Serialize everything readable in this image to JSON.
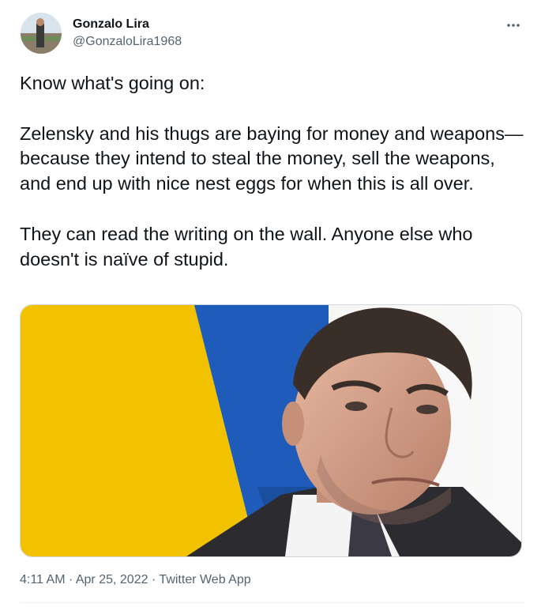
{
  "author": {
    "display_name": "Gonzalo Lira",
    "handle": "@GonzaloLira1968"
  },
  "menu_icon": "more-horizontal-icon",
  "tweet": {
    "paragraphs": [
      "Know what's going on:",
      "Zelensky and his thugs are baying for money and weapons—because they intend to steal the money, sell the weapons, and end up with nice nest eggs for when this is all over.",
      "They can read the writing on the wall. Anyone else who doesn't is naïve of stupid."
    ]
  },
  "meta": {
    "time": "4:11 AM",
    "separator": "·",
    "date": "Apr 25, 2022",
    "source": "Twitter Web App"
  },
  "colors": {
    "text_primary": "#0f1419",
    "text_secondary": "#536471",
    "border": "#cfd9de",
    "flag_blue": "#1f5bb8",
    "flag_yellow": "#f2c200"
  }
}
